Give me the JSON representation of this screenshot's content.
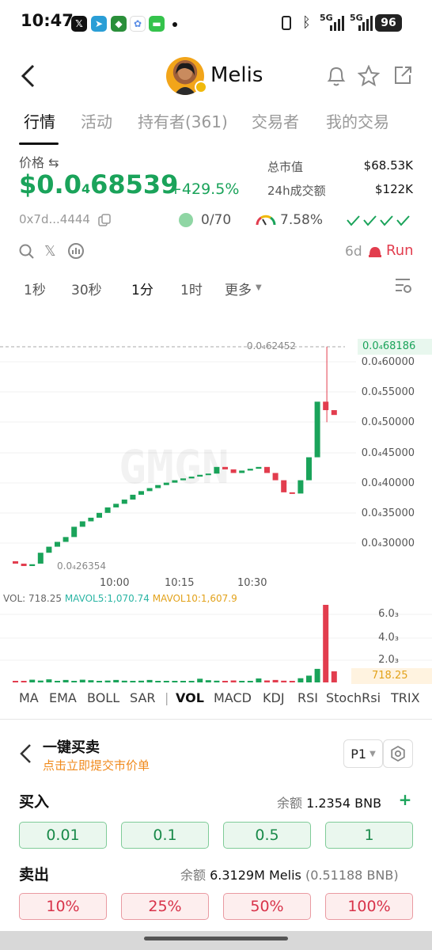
{
  "status": {
    "time": "10:47",
    "net1": "5G",
    "net2": "5G",
    "battery": "96"
  },
  "header": {
    "token_name": "Melis"
  },
  "tabs": [
    "行情",
    "活动",
    "持有者(361)",
    "交易者",
    "我的交易"
  ],
  "price": {
    "label": "价格 ⇆",
    "value_prefix": "$0.0",
    "value_sub": "4",
    "value_rest": "68539",
    "change": "+429.5%"
  },
  "stats": {
    "mcap_label": "总市值",
    "mcap": "$68.53K",
    "vol_label": "24h成交额",
    "vol": "$122K"
  },
  "address": "0x7d...4444",
  "chips": {
    "holders": "0/70",
    "gauge": "7.58%",
    "age": "6d",
    "run": "Run"
  },
  "timeframes": [
    "1秒",
    "30秒",
    "1分",
    "1时",
    "更多"
  ],
  "chart_labels": {
    "cur_line": "0.0₄62452",
    "cur_price": "0.0₄68186",
    "low_label": "0.0₄26354",
    "y_ticks": [
      "0.0₄60000",
      "0.0₄55000",
      "0.0₄50000",
      "0.0₄45000",
      "0.0₄40000",
      "0.0₄35000",
      "0.0₄30000"
    ],
    "x_ticks": [
      "10:00",
      "10:15",
      "10:30"
    ],
    "vol_ticks": [
      "6.0₃",
      "4.0₃",
      "2.0₃"
    ],
    "vol_cur": "718.25",
    "vol_legend": {
      "vol": "VOL: 718.25",
      "ma5": "MAVOL5:1,070.74",
      "ma10": "MAVOL10:1,607.9"
    }
  },
  "indicators": [
    "MA",
    "EMA",
    "BOLL",
    "SAR",
    "|",
    "VOL",
    "MACD",
    "KDJ",
    "RSI",
    "StochRsi",
    "TRIX"
  ],
  "trade": {
    "title": "一键买卖",
    "subtitle": "点击立即提交市价单",
    "preset": "P1",
    "buy_label": "买入",
    "buy_balance_label": "余额",
    "buy_balance": "1.2354 BNB",
    "buy_amounts": [
      "0.01",
      "0.1",
      "0.5",
      "1"
    ],
    "sell_label": "卖出",
    "sell_balance_label": "余额",
    "sell_balance": "6.3129M Melis",
    "sell_balance_bnb": "(0.51188 BNB)",
    "sell_pcts": [
      "10%",
      "25%",
      "50%",
      "100%"
    ]
  },
  "colors": {
    "up": "#1aa35a",
    "down": "#e23d4e",
    "accent": "#f08a1c"
  },
  "chart_data": {
    "type": "candlestick",
    "x_ticks": [
      "10:00",
      "10:15",
      "10:30"
    ],
    "ylim": [
      2.6354e-06,
      6.8186e-06
    ],
    "candles": [
      {
        "o": 27.0,
        "c": 26.6
      },
      {
        "o": 26.6,
        "c": 26.2
      },
      {
        "o": 26.2,
        "c": 26.5
      },
      {
        "o": 26.6,
        "c": 28.4
      },
      {
        "o": 28.4,
        "c": 29.4
      },
      {
        "o": 29.4,
        "c": 30.2
      },
      {
        "o": 30.2,
        "c": 31.0
      },
      {
        "o": 31.0,
        "c": 32.7
      },
      {
        "o": 32.7,
        "c": 33.6
      },
      {
        "o": 33.6,
        "c": 34.2
      },
      {
        "o": 34.2,
        "c": 35.0
      },
      {
        "o": 35.0,
        "c": 35.9
      },
      {
        "o": 35.9,
        "c": 36.5
      },
      {
        "o": 36.5,
        "c": 37.2
      },
      {
        "o": 37.2,
        "c": 38.0
      },
      {
        "o": 38.0,
        "c": 38.6
      },
      {
        "o": 38.6,
        "c": 39.1
      },
      {
        "o": 39.1,
        "c": 39.6
      },
      {
        "o": 39.6,
        "c": 40.0
      },
      {
        "o": 40.0,
        "c": 40.4
      },
      {
        "o": 40.4,
        "c": 40.7
      },
      {
        "o": 40.7,
        "c": 41.0
      },
      {
        "o": 41.0,
        "c": 41.3
      },
      {
        "o": 41.3,
        "c": 41.5
      },
      {
        "o": 41.5,
        "c": 42.6
      },
      {
        "o": 42.6,
        "c": 42.2
      },
      {
        "o": 42.2,
        "c": 41.6
      },
      {
        "o": 41.6,
        "c": 42.0
      },
      {
        "o": 42.0,
        "c": 42.3
      },
      {
        "o": 42.3,
        "c": 42.6
      },
      {
        "o": 42.6,
        "c": 41.6
      },
      {
        "o": 41.6,
        "c": 40.4
      },
      {
        "o": 40.4,
        "c": 38.4
      },
      {
        "o": 38.4,
        "c": 38.2
      },
      {
        "o": 38.2,
        "c": 40.4
      },
      {
        "o": 40.4,
        "c": 44.2
      },
      {
        "o": 44.2,
        "c": 53.4
      },
      {
        "o": 53.4,
        "c": 52.0
      },
      {
        "o": 52.0,
        "c": 51.2
      }
    ],
    "volume": [
      0.05,
      0.12,
      0.22,
      0.15,
      0.25,
      0.1,
      0.2,
      0.12,
      0.22,
      0.18,
      0.12,
      0.15,
      0.2,
      0.14,
      0.12,
      0.14,
      0.2,
      0.1,
      0.12,
      0.08,
      0.1,
      0.12,
      0.3,
      0.18,
      0.14,
      0.1,
      0.16,
      0.12,
      0.1,
      0.32,
      0.16,
      0.2,
      0.14,
      0.12,
      0.34,
      0.55,
      1.1,
      6.3,
      0.9
    ]
  }
}
